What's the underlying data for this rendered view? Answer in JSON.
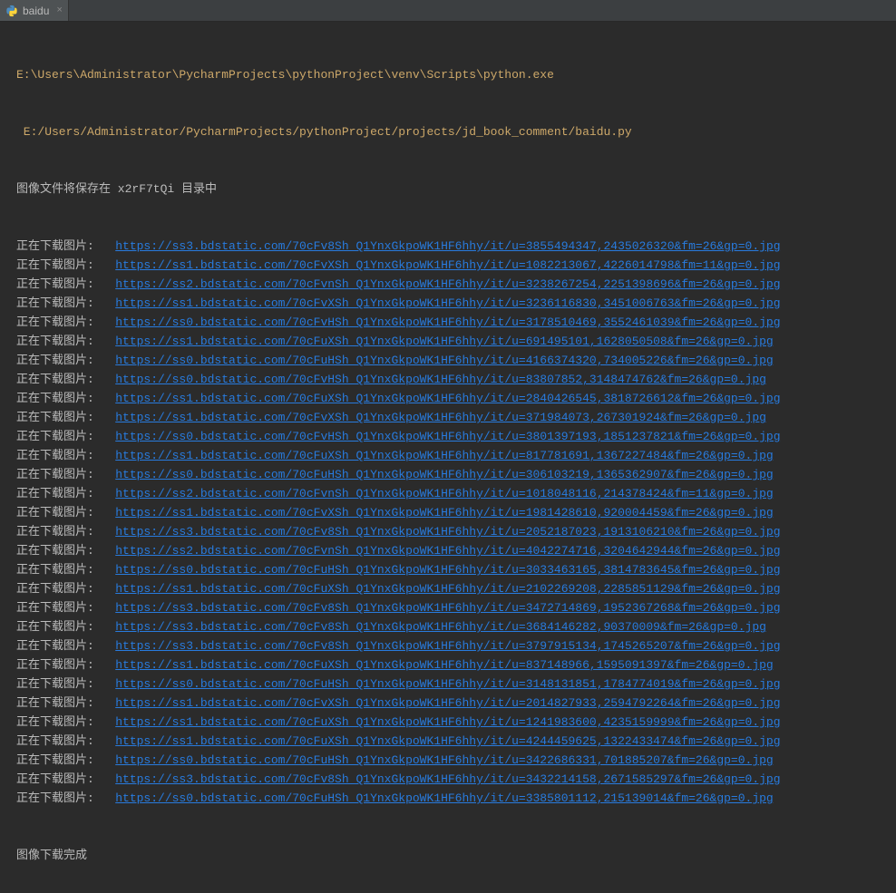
{
  "tab": {
    "label": "baidu",
    "close": "×"
  },
  "console": {
    "exe_line": "E:\\Users\\Administrator\\PycharmProjects\\pythonProject\\venv\\Scripts\\python.exe",
    "script_line": " E:/Users/Administrator/PycharmProjects/pythonProject/projects/jd_book_comment/baidu.py",
    "save_dir_line": "图像文件将保存在 x2rF7tQi 目录中",
    "download_prefix": "正在下载图片:   ",
    "urls": [
      "https://ss3.bdstatic.com/70cFv8Sh_Q1YnxGkpoWK1HF6hhy/it/u=3855494347,2435026320&fm=26&gp=0.jpg",
      "https://ss1.bdstatic.com/70cFvXSh_Q1YnxGkpoWK1HF6hhy/it/u=1082213067,4226014798&fm=11&gp=0.jpg",
      "https://ss2.bdstatic.com/70cFvnSh_Q1YnxGkpoWK1HF6hhy/it/u=3238267254,2251398696&fm=26&gp=0.jpg",
      "https://ss1.bdstatic.com/70cFvXSh_Q1YnxGkpoWK1HF6hhy/it/u=3236116830,3451006763&fm=26&gp=0.jpg",
      "https://ss0.bdstatic.com/70cFvHSh_Q1YnxGkpoWK1HF6hhy/it/u=3178510469,3552461039&fm=26&gp=0.jpg",
      "https://ss1.bdstatic.com/70cFuXSh_Q1YnxGkpoWK1HF6hhy/it/u=691495101,1628050508&fm=26&gp=0.jpg",
      "https://ss0.bdstatic.com/70cFuHSh_Q1YnxGkpoWK1HF6hhy/it/u=4166374320,734005226&fm=26&gp=0.jpg",
      "https://ss0.bdstatic.com/70cFvHSh_Q1YnxGkpoWK1HF6hhy/it/u=83807852,3148474762&fm=26&gp=0.jpg",
      "https://ss1.bdstatic.com/70cFuXSh_Q1YnxGkpoWK1HF6hhy/it/u=2840426545,3818726612&fm=26&gp=0.jpg",
      "https://ss1.bdstatic.com/70cFvXSh_Q1YnxGkpoWK1HF6hhy/it/u=371984073,267301924&fm=26&gp=0.jpg",
      "https://ss0.bdstatic.com/70cFvHSh_Q1YnxGkpoWK1HF6hhy/it/u=3801397193,1851237821&fm=26&gp=0.jpg",
      "https://ss1.bdstatic.com/70cFuXSh_Q1YnxGkpoWK1HF6hhy/it/u=817781691,1367227484&fm=26&gp=0.jpg",
      "https://ss0.bdstatic.com/70cFuHSh_Q1YnxGkpoWK1HF6hhy/it/u=306103219,1365362907&fm=26&gp=0.jpg",
      "https://ss2.bdstatic.com/70cFvnSh_Q1YnxGkpoWK1HF6hhy/it/u=1018048116,214378424&fm=11&gp=0.jpg",
      "https://ss1.bdstatic.com/70cFvXSh_Q1YnxGkpoWK1HF6hhy/it/u=1981428610,920004459&fm=26&gp=0.jpg",
      "https://ss3.bdstatic.com/70cFv8Sh_Q1YnxGkpoWK1HF6hhy/it/u=2052187023,1913106210&fm=26&gp=0.jpg",
      "https://ss2.bdstatic.com/70cFvnSh_Q1YnxGkpoWK1HF6hhy/it/u=4042274716,3204642944&fm=26&gp=0.jpg",
      "https://ss0.bdstatic.com/70cFuHSh_Q1YnxGkpoWK1HF6hhy/it/u=3033463165,3814783645&fm=26&gp=0.jpg",
      "https://ss1.bdstatic.com/70cFuXSh_Q1YnxGkpoWK1HF6hhy/it/u=2102269208,2285851129&fm=26&gp=0.jpg",
      "https://ss3.bdstatic.com/70cFv8Sh_Q1YnxGkpoWK1HF6hhy/it/u=3472714869,1952367268&fm=26&gp=0.jpg",
      "https://ss3.bdstatic.com/70cFv8Sh_Q1YnxGkpoWK1HF6hhy/it/u=3684146282,90370009&fm=26&gp=0.jpg",
      "https://ss3.bdstatic.com/70cFv8Sh_Q1YnxGkpoWK1HF6hhy/it/u=3797915134,1745265207&fm=26&gp=0.jpg",
      "https://ss1.bdstatic.com/70cFuXSh_Q1YnxGkpoWK1HF6hhy/it/u=837148966,1595091397&fm=26&gp=0.jpg",
      "https://ss0.bdstatic.com/70cFuHSh_Q1YnxGkpoWK1HF6hhy/it/u=3148131851,1784774019&fm=26&gp=0.jpg",
      "https://ss1.bdstatic.com/70cFvXSh_Q1YnxGkpoWK1HF6hhy/it/u=2014827933,2594792264&fm=26&gp=0.jpg",
      "https://ss1.bdstatic.com/70cFuXSh_Q1YnxGkpoWK1HF6hhy/it/u=1241983600,4235159999&fm=26&gp=0.jpg",
      "https://ss1.bdstatic.com/70cFuXSh_Q1YnxGkpoWK1HF6hhy/it/u=4244459625,1322433474&fm=26&gp=0.jpg",
      "https://ss0.bdstatic.com/70cFuHSh_Q1YnxGkpoWK1HF6hhy/it/u=3422686331,701885207&fm=26&gp=0.jpg",
      "https://ss3.bdstatic.com/70cFv8Sh_Q1YnxGkpoWK1HF6hhy/it/u=3432214158,2671585297&fm=26&gp=0.jpg",
      "https://ss0.bdstatic.com/70cFuHSh_Q1YnxGkpoWK1HF6hhy/it/u=3385801112,215139014&fm=26&gp=0.jpg"
    ],
    "done_line": "图像下载完成"
  }
}
